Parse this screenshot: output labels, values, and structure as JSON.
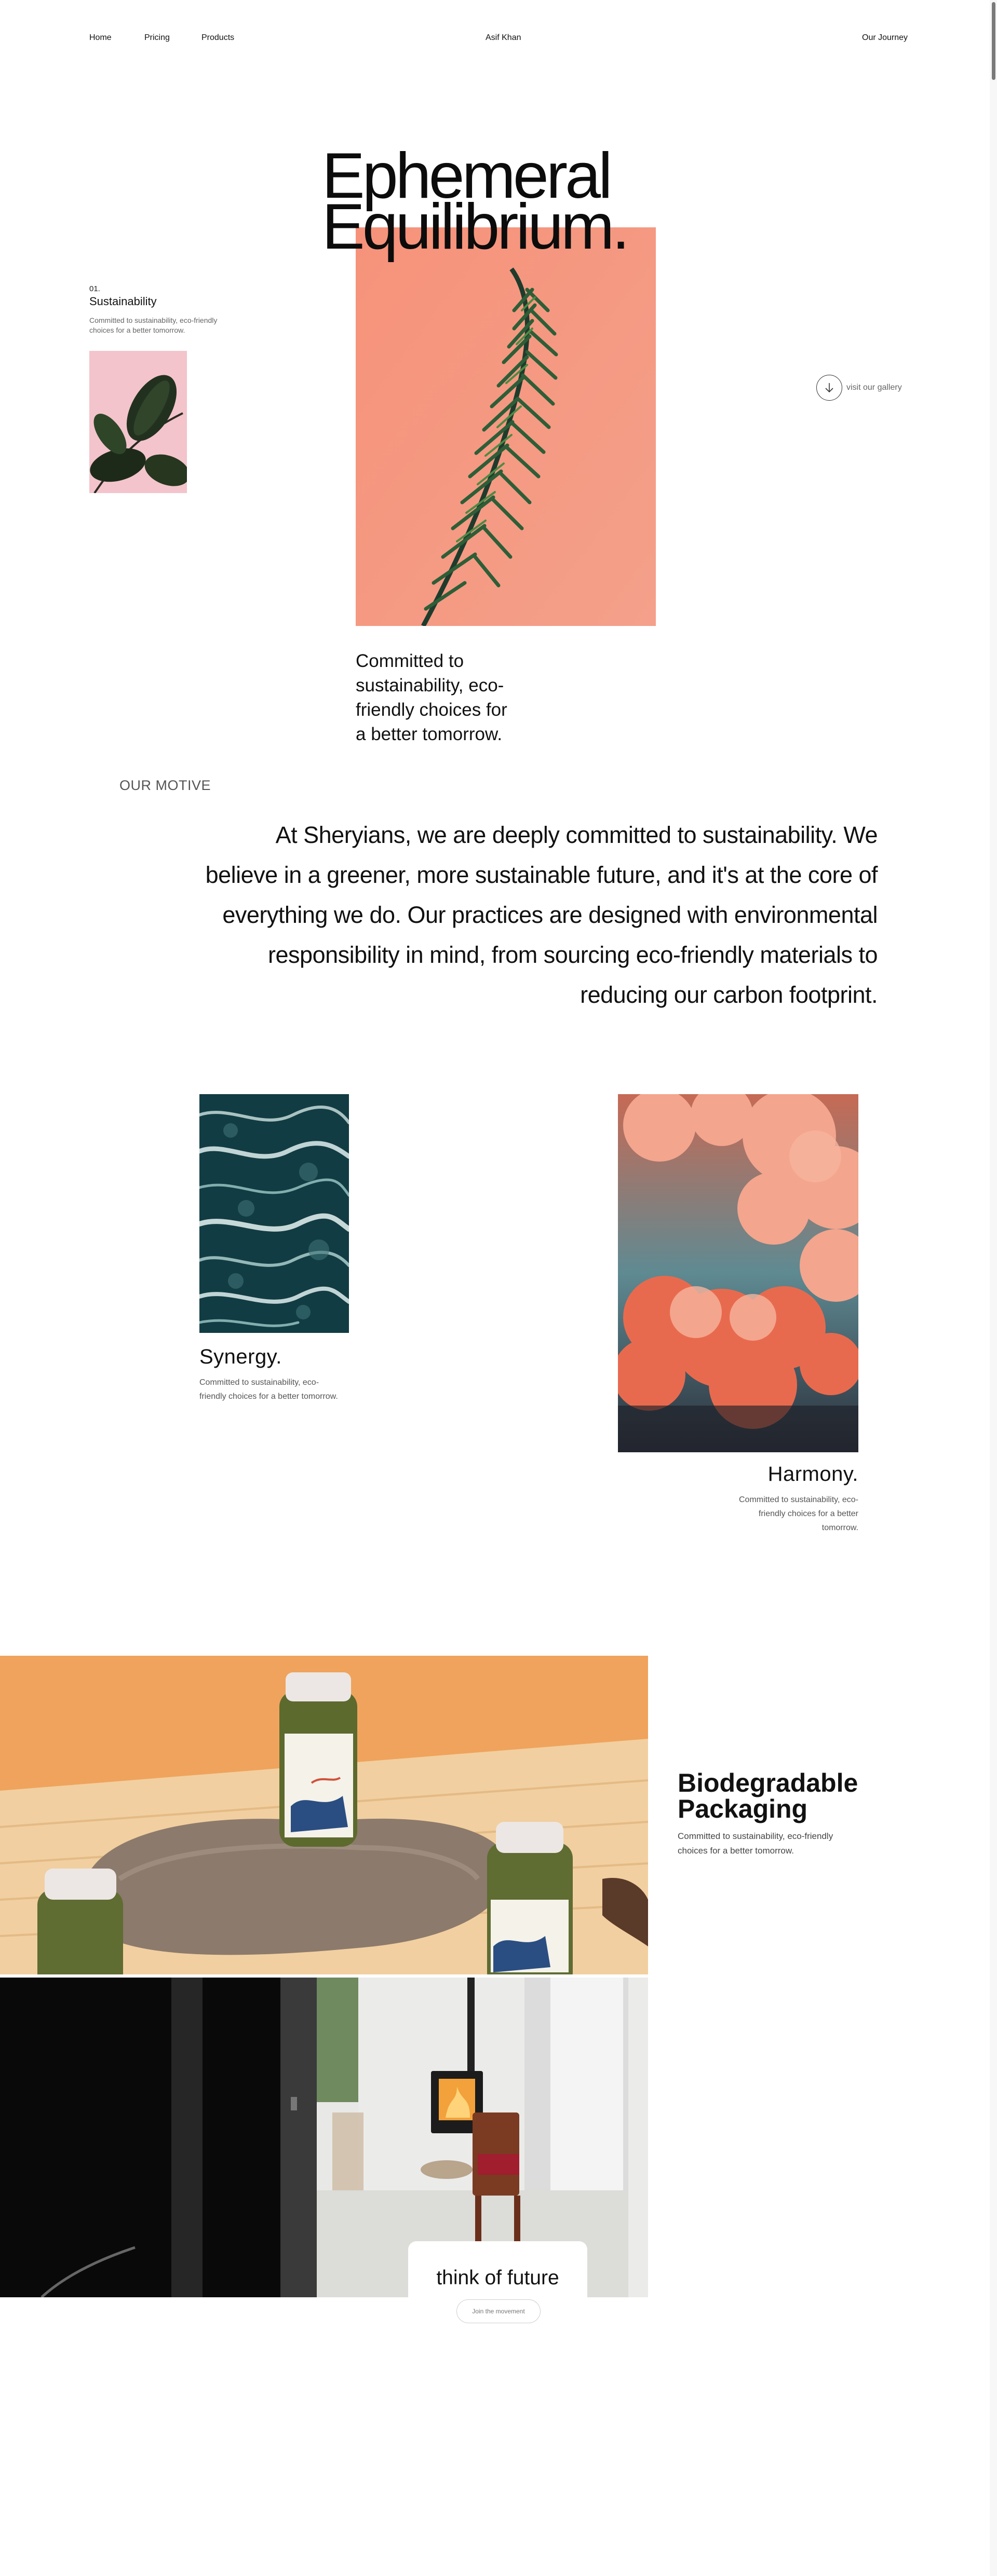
{
  "nav": {
    "home": "Home",
    "pricing": "Pricing",
    "products": "Products",
    "brand": "Asif Khan",
    "journey": "Our Journey"
  },
  "hero": {
    "title_line1": "Ephemeral",
    "title_line2": "Equilibrium.",
    "number": "01.",
    "heading": "Sustainability",
    "small_text": "Committed to sustainability, eco-friendly choices for a better tomorrow.",
    "gallery_label": "visit our gallery",
    "caption": "Committed to sustainability, eco-friendly choices for a better tomorrow."
  },
  "motive": {
    "label": "OUR MOTIVE",
    "text": "At Sheryians, we are deeply committed to sustainability. We believe in a greener, more sustainable future, and it's at the core of everything we do. Our practices are designed with environmental responsibility in mind, from sourcing eco-friendly materials to reducing our carbon footprint."
  },
  "cards": {
    "synergy_title": "Synergy.",
    "synergy_text": "Committed to sustainability, eco-friendly choices for a better tomorrow.",
    "harmony_title": "Harmony.",
    "harmony_text": "Committed to sustainability, eco-friendly choices for a better tomorrow."
  },
  "packaging": {
    "title": "Biodegradable Packaging",
    "text": "Committed to sustainability, eco-friendly choices for a better tomorrow."
  },
  "future": {
    "title": "think of future",
    "button": "Join the movement"
  },
  "icons": {
    "gallery": "arrow-down-icon"
  },
  "colors": {
    "accent_coral": "#f79a7d",
    "orange_backdrop": "#f0a35c",
    "text": "#111111"
  }
}
